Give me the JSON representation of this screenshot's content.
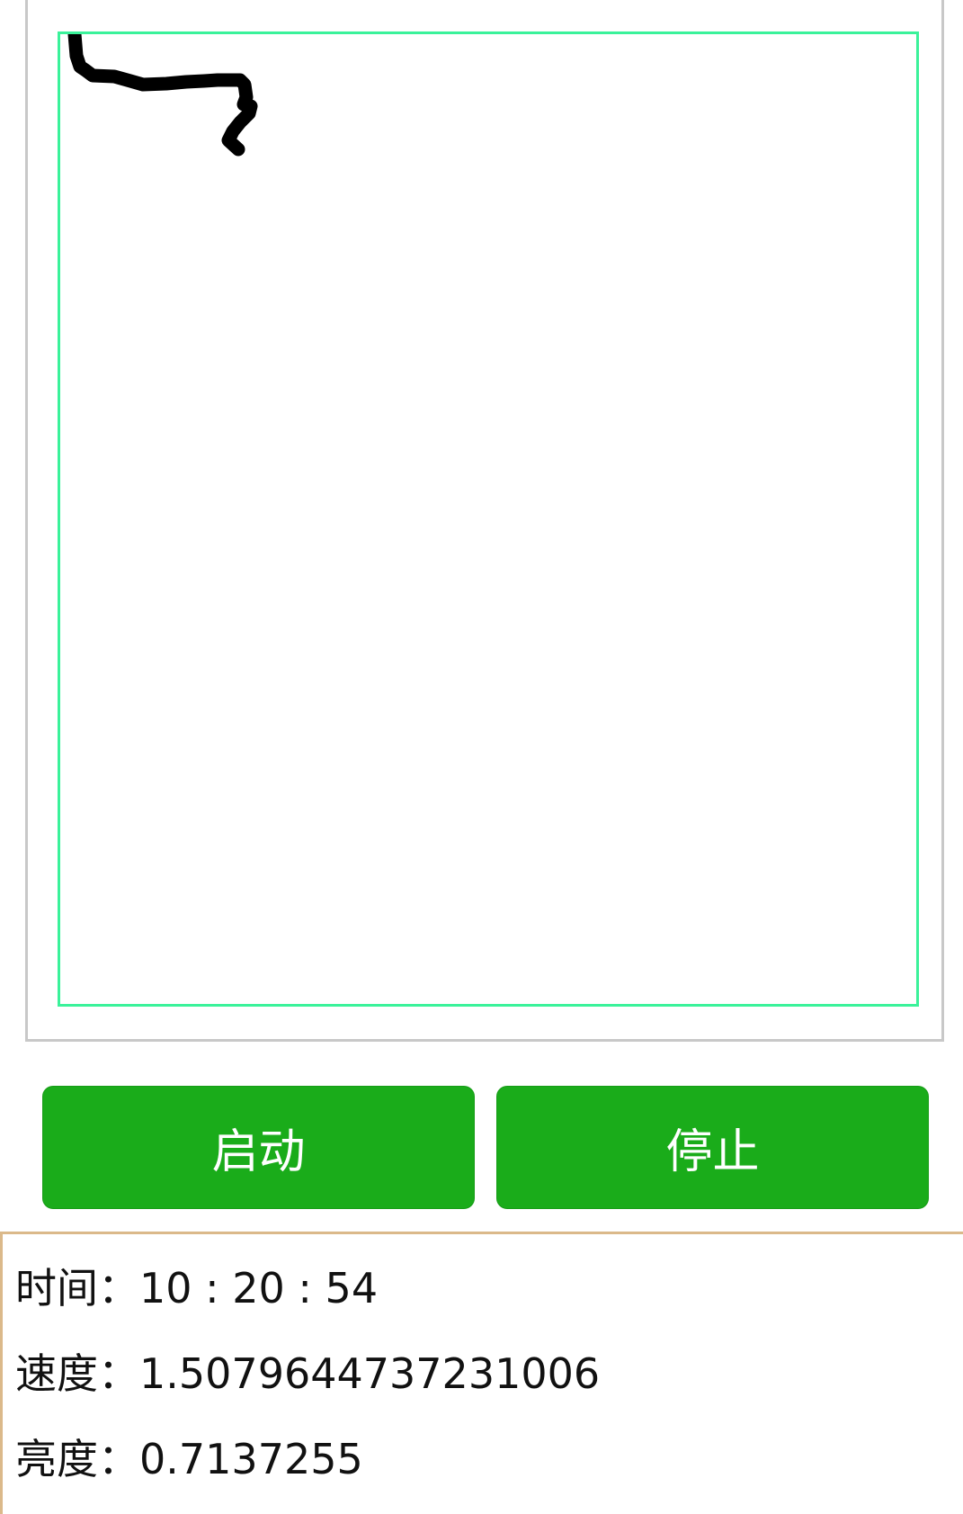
{
  "controls": {
    "start_label": "启动",
    "stop_label": "停止"
  },
  "stats": {
    "time_label": "时间：",
    "time_value": "10 : 20 : 54",
    "speed_label": "速度：",
    "speed_value": "1.5079644737231006",
    "brightness_label": "亮度：",
    "brightness_value": "0.7137255"
  },
  "colors": {
    "button": "#1aac1a",
    "draw_border": "#3af29a",
    "panel_border": "#dbb98a"
  }
}
